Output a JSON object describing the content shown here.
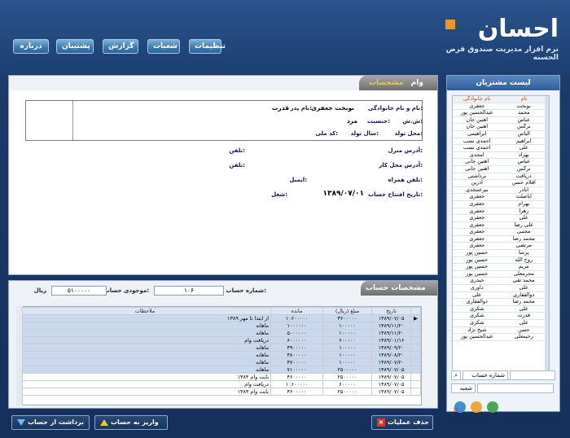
{
  "brand": {
    "word": "احسان",
    "subtitle": "نرم افزار مدیریت صندوق قرض الحسنه"
  },
  "menu": [
    "تنظیمات",
    "شعبات",
    "گزارش",
    "پشتیبان",
    "درباره"
  ],
  "sidebar": {
    "title": "لیست مشتریان",
    "col_name": "نام",
    "col_family": "نام خانوادگی",
    "rows": [
      [
        "نوبخت",
        "جعفری"
      ],
      [
        "محمد",
        "عبدالحسین پور"
      ],
      [
        "عباس",
        "آهنین جان"
      ],
      [
        "نرگس",
        "آهنین جان"
      ],
      [
        "الیاس",
        "ابراهیمی"
      ],
      [
        "ابراهیم",
        "احمدی نسب"
      ],
      [
        "علی",
        "احمدی نسب"
      ],
      [
        "بهزاد",
        "امجدی"
      ],
      [
        "عباس",
        "آهنین جانی"
      ],
      [
        "نرگس",
        "آهنین جانی"
      ],
      [
        "دریافت",
        "برداشتی"
      ],
      [
        "اقلام حسن",
        "آذرین"
      ],
      [
        "اباذر",
        "بیرعمجدی"
      ],
      [
        "اباصلت",
        "جعفری"
      ],
      [
        "بهرام",
        "جعفری"
      ],
      [
        "زهرا",
        "جعفری"
      ],
      [
        "علی",
        "جعفری"
      ],
      [
        "علی رضا",
        "جعفری"
      ],
      [
        "مجتبی",
        "جعفری"
      ],
      [
        "محمد رضا",
        "جعفری"
      ],
      [
        "مرتضی",
        "جعفری"
      ],
      [
        "پرسا",
        "حسین پور"
      ],
      [
        "روح الله",
        "حسین پور"
      ],
      [
        "مریم",
        "حسین پور"
      ],
      [
        "محرمعلی",
        "حسین پور"
      ],
      [
        "محمد تقی",
        "حیدری"
      ],
      [
        "علی",
        "داوری"
      ],
      [
        "ذوالفقاری",
        "علی"
      ],
      [
        "محمد رضا",
        "ذوالفقاری"
      ],
      [
        "علی",
        "شکری"
      ],
      [
        "قدرت",
        "شکری"
      ],
      [
        "علی",
        "شکری"
      ],
      [
        "حسن",
        "شیخ نژاد"
      ],
      [
        "رحیمعلی",
        "عبدالحسین پور"
      ]
    ],
    "search_type": "شماره حساب",
    "branch": "شعبه"
  },
  "info": {
    "tab_active": "مشخصات",
    "tab_other": "وام",
    "name_label": "نام و نام خانوادگی:",
    "name_value": "نوبخت جعفری",
    "father_label": "نام پدر:",
    "father_value": "قدرت",
    "id_label": "ش.ش:",
    "gender_label": "جنسیت:",
    "gender_value": "مرد",
    "birthplace_label": "محل تولد:",
    "birthyear_label": "سال تولد:",
    "national_label": "کد ملی:",
    "home_label": "آدرس منزل:",
    "work_label": "آدرس محل کار:",
    "phone1_label": "تلفن:",
    "phone2_label": "تلفن:",
    "mobile_label": "تلفن همراه:",
    "email_label": "ایمیل:",
    "open_label": "تاریخ افتتاح حساب:",
    "open_value": "۱۳۸۹/۰۷/۰۱",
    "job_label": "شغل:"
  },
  "account": {
    "title": "مشخصات حساب",
    "number_label": "شماره حساب:",
    "number_value": "۱۰۶",
    "balance_label": "موجودی حساب:",
    "balance_value": "۵۱۰۰۰۰۰",
    "currency": "ریال"
  },
  "grid": {
    "headers": [
      "تاریخ",
      "مبلغ (ریال)",
      "مانده",
      "ملاحظات"
    ],
    "rows": [
      [
        "۱۳۸۹/۰۷/۰۵",
        "۳۶۰۰۰۰۰",
        "۱۰۶۰۰۰۰۰",
        "از ابتدا تا مهر ۱۳۸۹"
      ],
      [
        "۱۳۸۹/۱۱/۲۰",
        "۱۰۰۰۰۰",
        "۱۰۰۰۰۰۰",
        "ماهانه"
      ],
      [
        "۱۳۸۹/۱۱/۲۰",
        "۱۰۰۰۰۰",
        "۵۰۰۰۰۰۰",
        "ماهانه"
      ],
      [
        "۱۳۸۹/۰۱/۱۶",
        "۶۰۰۰۰۰",
        "۶۰۰۰۰۰۰",
        "دریافت وام"
      ],
      [
        "۱۳۸۹/۰۹/۲۰",
        "۱۰۰۰۰۰",
        "۴۹۰۰۰۰۰",
        "ماهانه"
      ],
      [
        "۱۳۸۹/۰۸/۲۰",
        "۱۰۰۰۰۰",
        "۴۸۰۰۰۰۰",
        "ماهانه"
      ],
      [
        "۱۳۸۹/۰۷/۲۰",
        "۱۰۰۰۰۰",
        "۴۷۰۰۰۰۰",
        "ماهانه"
      ],
      [
        "۱۳۸۹/۰۷/۰۵",
        "۲۵۰۰۰۰۰",
        "۷۱۰۰۰۰۰",
        "ماهانه"
      ],
      [
        "۱۳۸۹/۰۷/۰۵",
        "۲۵۰۰۰۰۰",
        "۴۶۰۰۰۰۰",
        "بابت وام ۱۳۸۴"
      ],
      [
        "۱۳۸۹/۰۷/۰۵",
        "۶۰۰۰۰۰",
        "۱۰۶۰۰۰۰۰",
        "دریافت وام"
      ],
      [
        "۱۳۸۹/۰۷/۰۵",
        "۲۵۰۰۰۰۰",
        "۴۶۰۰۰۰۰",
        "بابت وام ۱۳۸۴"
      ]
    ]
  },
  "actions": {
    "withdraw": "برداشت از حساب",
    "deposit": "واریز به حساب",
    "delete": "حذف عملیات"
  },
  "colors": {
    "accent_orange": "#f39321",
    "label_blue": "#11115a"
  }
}
